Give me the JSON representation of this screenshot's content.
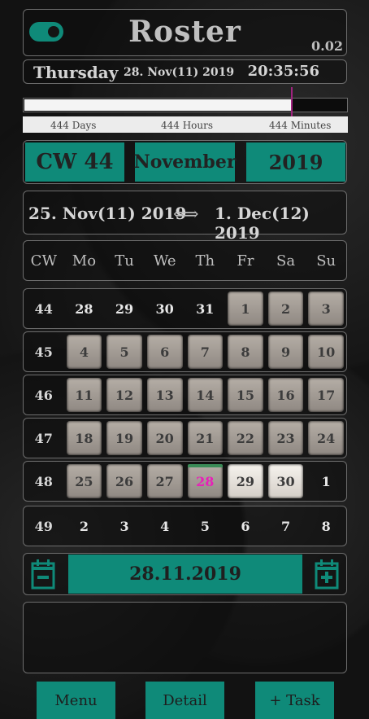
{
  "header": {
    "title": "Roster",
    "version": "0.02",
    "toggle": "on"
  },
  "date_line": {
    "weekday": "Thursday",
    "date": "28. Nov(11) 2019",
    "time": "20:35:56"
  },
  "progress": {
    "fraction": 0.83,
    "days": "444 Days",
    "hours": "444 Hours",
    "minutes": "444 Minutes"
  },
  "selectors": {
    "week": "CW 44",
    "month": "November",
    "year": "2019"
  },
  "range": {
    "start": "25. Nov(11) 2019",
    "end": "1. Dec(12) 2019"
  },
  "calendar": {
    "headers": [
      "CW",
      "Mo",
      "Tu",
      "We",
      "Th",
      "Fr",
      "Sa",
      "Su"
    ],
    "weeks": [
      {
        "cw": "44",
        "days": [
          "28",
          "29",
          "30",
          "31",
          "1",
          "2",
          "3"
        ]
      },
      {
        "cw": "45",
        "days": [
          "4",
          "5",
          "6",
          "7",
          "8",
          "9",
          "10"
        ]
      },
      {
        "cw": "46",
        "days": [
          "11",
          "12",
          "13",
          "14",
          "15",
          "16",
          "17"
        ]
      },
      {
        "cw": "47",
        "days": [
          "18",
          "19",
          "20",
          "21",
          "22",
          "23",
          "24"
        ]
      },
      {
        "cw": "48",
        "days": [
          "25",
          "26",
          "27",
          "28",
          "29",
          "30",
          "1"
        ]
      },
      {
        "cw": "49",
        "days": [
          "2",
          "3",
          "4",
          "5",
          "6",
          "7",
          "8"
        ]
      }
    ]
  },
  "date_picker": {
    "value": "28.11.2019"
  },
  "buttons": {
    "menu": "Menu",
    "detail": "Detail",
    "task": "+ Task"
  },
  "colors": {
    "accent": "#0f8a79",
    "today": "#e820b8",
    "marker": "#a0237f"
  }
}
